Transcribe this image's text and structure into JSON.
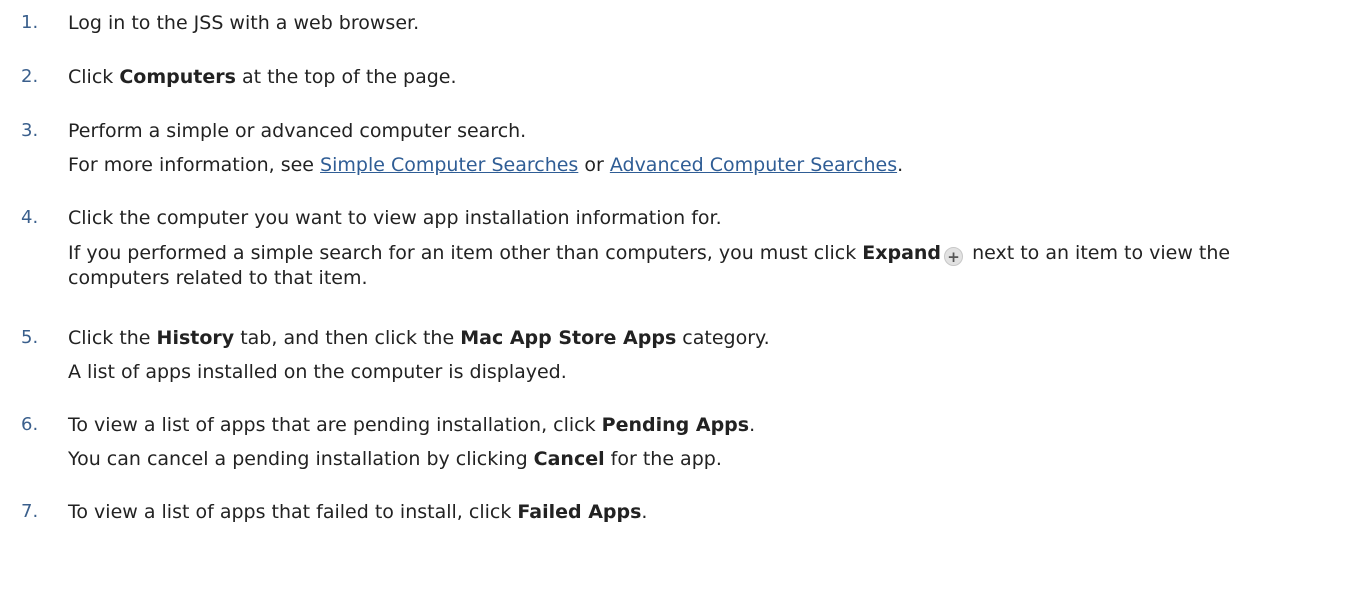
{
  "steps": [
    {
      "num": "1.",
      "main": {
        "t1": "Log in to the JSS with a web browser."
      }
    },
    {
      "num": "2.",
      "main": {
        "pre": "Click ",
        "bold": "Computers",
        "post": " at the top of the page."
      }
    },
    {
      "num": "3.",
      "main": {
        "t1": "Perform a simple or advanced computer search."
      },
      "sub": {
        "pre": "For more information, see ",
        "link1": "Simple Computer Searches",
        "mid": " or ",
        "link2": "Advanced Computer Searches",
        "post": "."
      }
    },
    {
      "num": "4.",
      "main": {
        "t1": "Click the computer you want to view app installation information for."
      },
      "sub": {
        "pre": "If you performed a simple search for an item other than computers, you must click ",
        "bold": "Expand",
        "post": " next to an item to view the computers related to that item."
      }
    },
    {
      "num": "5.",
      "main": {
        "pre": "Click the ",
        "bold1": "History",
        "mid": " tab, and then click the ",
        "bold2": "Mac App Store Apps",
        "post": " category."
      },
      "sub": {
        "t1": "A list of apps installed on the computer is displayed."
      }
    },
    {
      "num": "6.",
      "main": {
        "pre": "To view a list of apps that are pending installation, click ",
        "bold": "Pending Apps",
        "post": "."
      },
      "sub": {
        "pre": "You can cancel a pending installation by clicking ",
        "bold": "Cancel",
        "post": " for the app."
      }
    },
    {
      "num": "7.",
      "main": {
        "pre": "To view a list of apps that failed to install, click ",
        "bold": "Failed Apps",
        "post": "."
      }
    }
  ],
  "icons": {
    "expand": "plus-circle-icon",
    "expand_glyph": "+"
  },
  "colors": {
    "text": "#222222",
    "number": "#3a5f8c",
    "link": "#2f5d95"
  }
}
